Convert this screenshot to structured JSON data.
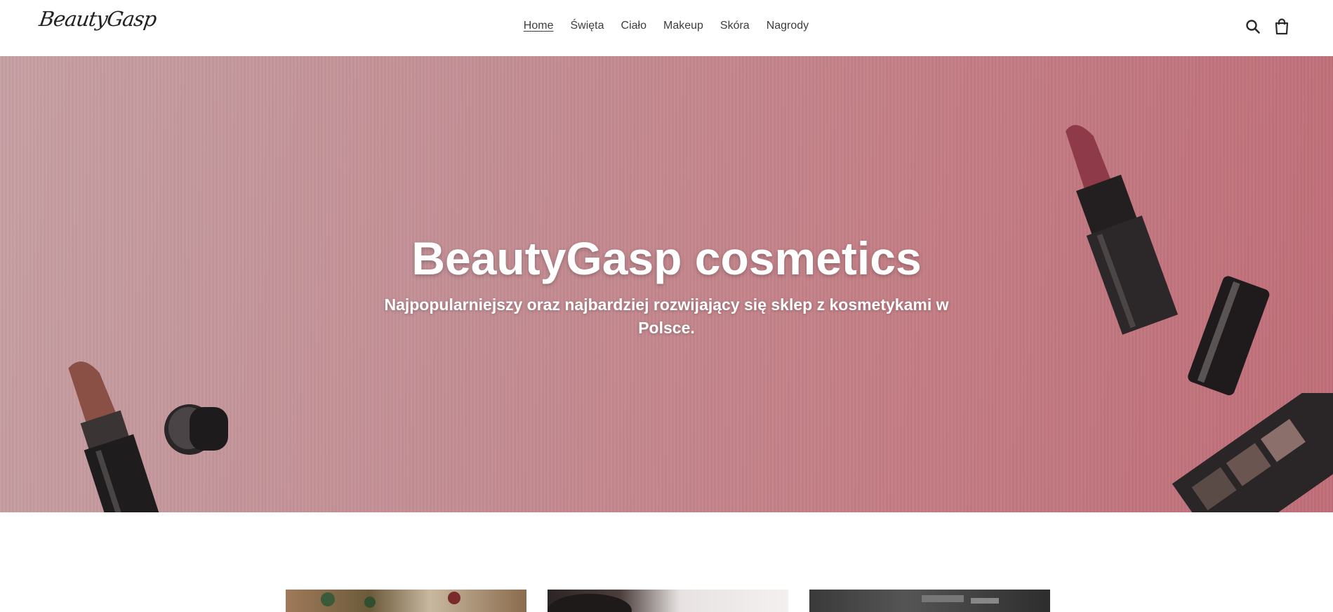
{
  "header": {
    "logo": "BeautyGasp",
    "nav": [
      {
        "label": "Home",
        "active": true
      },
      {
        "label": "Święta",
        "active": false
      },
      {
        "label": "Ciało",
        "active": false
      },
      {
        "label": "Makeup",
        "active": false
      },
      {
        "label": "Skóra",
        "active": false
      },
      {
        "label": "Nagrody",
        "active": false
      }
    ],
    "icons": [
      "search-icon",
      "cart-icon"
    ]
  },
  "hero": {
    "title": "BeautyGasp cosmetics",
    "subtitle": "Najpopularniejszy oraz najbardziej rozwijający się sklep z kosmetykami w Polsce.",
    "bg_color": "#c38f95"
  },
  "collections": {
    "tiles": [
      "holiday-gifts-image",
      "portrait-image",
      "makeup-brushes-image"
    ]
  }
}
